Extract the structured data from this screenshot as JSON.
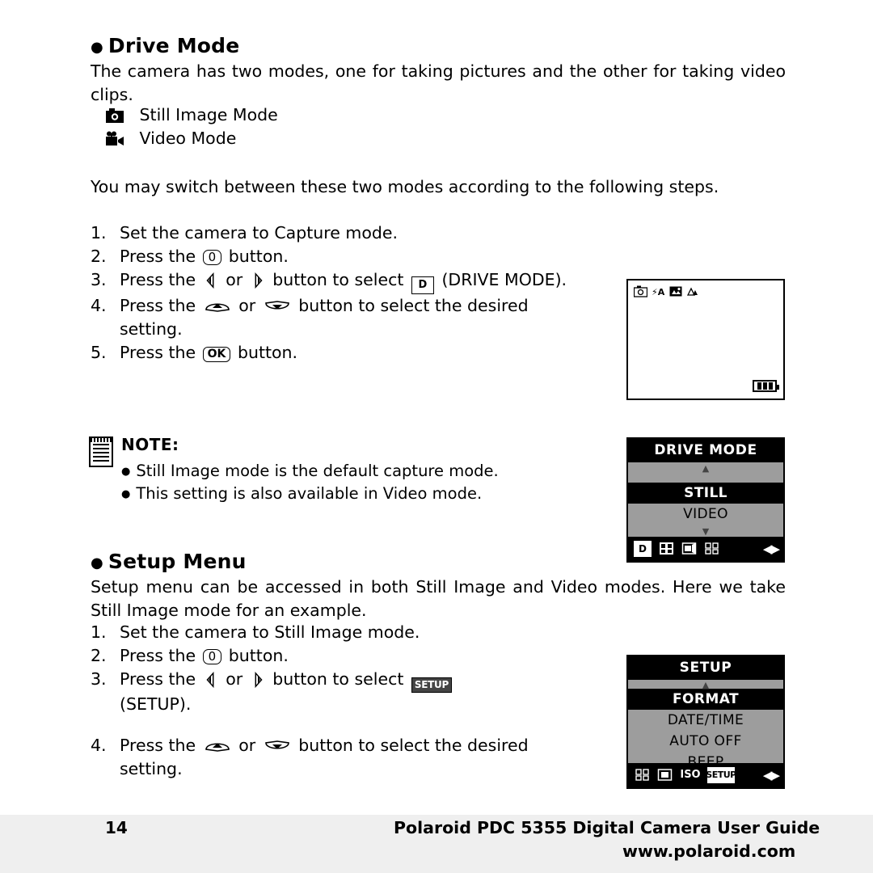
{
  "sections": {
    "drive_mode": {
      "heading": "Drive Mode",
      "intro": "The camera has two modes, one for taking pictures and the other for taking video clips.",
      "mode_still": "Still Image Mode",
      "mode_video": "Video Mode",
      "switch_text": "You may switch between these two modes according to the following steps.",
      "steps": [
        {
          "num": "1.",
          "text": "Set the camera to Capture mode."
        },
        {
          "num": "2.",
          "pre": "Press the",
          "key": "0",
          "post": "button."
        },
        {
          "num": "3.",
          "pre": "Press the",
          "mid": "or",
          "post": "button to select",
          "icon": "D",
          "tail": "(DRIVE MODE)."
        },
        {
          "num": "4.",
          "pre": "Press the",
          "mid": "or",
          "post": "button to select the desired setting."
        },
        {
          "num": "5.",
          "pre": "Press the",
          "key": "OK",
          "post": "button."
        }
      ]
    },
    "note": {
      "title": "NOTE:",
      "items": [
        "Still Image mode is the default capture mode.",
        "This setting is also available in Video mode."
      ]
    },
    "setup_menu": {
      "heading": "Setup Menu",
      "intro": "Setup menu can be accessed in both Still Image and Video modes. Here we take Still Image mode for an example.",
      "steps": [
        {
          "num": "1.",
          "text": "Set the camera to Still Image mode."
        },
        {
          "num": "2.",
          "pre": "Press the",
          "key": "0",
          "post": "button."
        },
        {
          "num": "3.",
          "pre": "Press the",
          "mid": "or",
          "post": "button to select",
          "icon": "SETUP",
          "tail": "(SETUP)."
        },
        {
          "num": "4.",
          "pre": "Press the",
          "mid": "or",
          "post": "button to select the desired setting."
        }
      ]
    }
  },
  "lcd_preview": {
    "icons": [
      "camera-icon",
      "flash-auto-icon",
      "scene-icon",
      "macro-icon"
    ],
    "battery": "battery-full-icon"
  },
  "lcd_drive": {
    "title": "DRIVE MODE",
    "rows": [
      {
        "label": "STILL",
        "selected": true
      },
      {
        "label": "VIDEO",
        "selected": false
      }
    ],
    "tabs": [
      {
        "name": "drive-tab",
        "glyph": "D",
        "active": true
      },
      {
        "name": "quality-tab",
        "glyph": "✣",
        "active": false
      },
      {
        "name": "capture-tab",
        "glyph": "▣",
        "active": false
      },
      {
        "name": "effect-tab",
        "glyph": "❈",
        "active": false
      }
    ],
    "nav": "◀▶"
  },
  "lcd_setup": {
    "title": "SETUP",
    "rows": [
      {
        "label": "FORMAT",
        "selected": true
      },
      {
        "label": "DATE/TIME",
        "selected": false
      },
      {
        "label": "AUTO OFF",
        "selected": false
      },
      {
        "label": "BEEP",
        "selected": false
      }
    ],
    "tabs": [
      {
        "name": "effect-tab",
        "glyph": "❈",
        "active": false
      },
      {
        "name": "exposure-tab",
        "glyph": "▣",
        "active": false
      },
      {
        "name": "iso-tab",
        "glyph": "ISO",
        "active": false
      },
      {
        "name": "setup-tab",
        "glyph": "SETUP",
        "active": true
      }
    ],
    "nav": "◀▶"
  },
  "footer": {
    "page_number": "14",
    "line1": "Polaroid PDC 5355 Digital Camera User Guide",
    "line2": "www.polaroid.com"
  }
}
